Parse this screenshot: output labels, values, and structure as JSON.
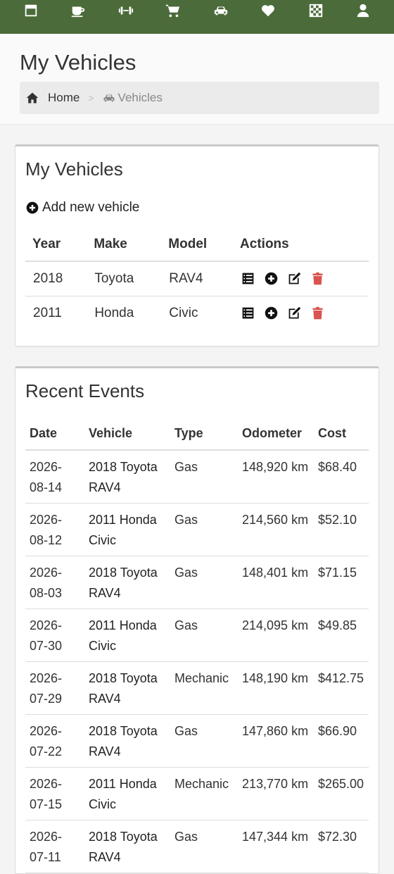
{
  "nav": {
    "icons": [
      "calendar-icon",
      "coffee-icon",
      "dumbbell-icon",
      "cart-icon",
      "car-icon",
      "heartbeat-icon",
      "chess-board-icon",
      "user-icon"
    ],
    "color": "#4b6b3a"
  },
  "header": {
    "title": "My Vehicles",
    "breadcrumb": {
      "home": "Home",
      "separator": ">",
      "current": "Vehicles"
    }
  },
  "vehicles_card": {
    "title": "My Vehicles",
    "add_label": "Add new vehicle",
    "columns": [
      "Year",
      "Make",
      "Model",
      "Actions"
    ],
    "rows": [
      {
        "year": "2018",
        "make": "Toyota",
        "model": "RAV4"
      },
      {
        "year": "2011",
        "make": "Honda",
        "model": "Civic"
      }
    ],
    "delete_color": "#d9534f"
  },
  "events_card": {
    "title": "Recent Events",
    "columns": [
      "Date",
      "Vehicle",
      "Type",
      "Odometer",
      "Cost"
    ],
    "rows": [
      {
        "date": "2026-08-14",
        "vehicle": "2018 Toyota RAV4",
        "type": "Gas",
        "odometer": "148,920 km",
        "cost": "$68.40"
      },
      {
        "date": "2026-08-12",
        "vehicle": "2011 Honda Civic",
        "type": "Gas",
        "odometer": "214,560 km",
        "cost": "$52.10"
      },
      {
        "date": "2026-08-03",
        "vehicle": "2018 Toyota RAV4",
        "type": "Gas",
        "odometer": "148,401 km",
        "cost": "$71.15"
      },
      {
        "date": "2026-07-30",
        "vehicle": "2011 Honda Civic",
        "type": "Gas",
        "odometer": "214,095 km",
        "cost": "$49.85"
      },
      {
        "date": "2026-07-29",
        "vehicle": "2018 Toyota RAV4",
        "type": "Mechanic",
        "odometer": "148,190 km",
        "cost": "$412.75"
      },
      {
        "date": "2026-07-22",
        "vehicle": "2018 Toyota RAV4",
        "type": "Gas",
        "odometer": "147,860 km",
        "cost": "$66.90"
      },
      {
        "date": "2026-07-15",
        "vehicle": "2011 Honda Civic",
        "type": "Mechanic",
        "odometer": "213,770 km",
        "cost": "$265.00"
      },
      {
        "date": "2026-07-11",
        "vehicle": "2018 Toyota RAV4",
        "type": "Gas",
        "odometer": "147,344 km",
        "cost": "$72.30"
      }
    ]
  }
}
